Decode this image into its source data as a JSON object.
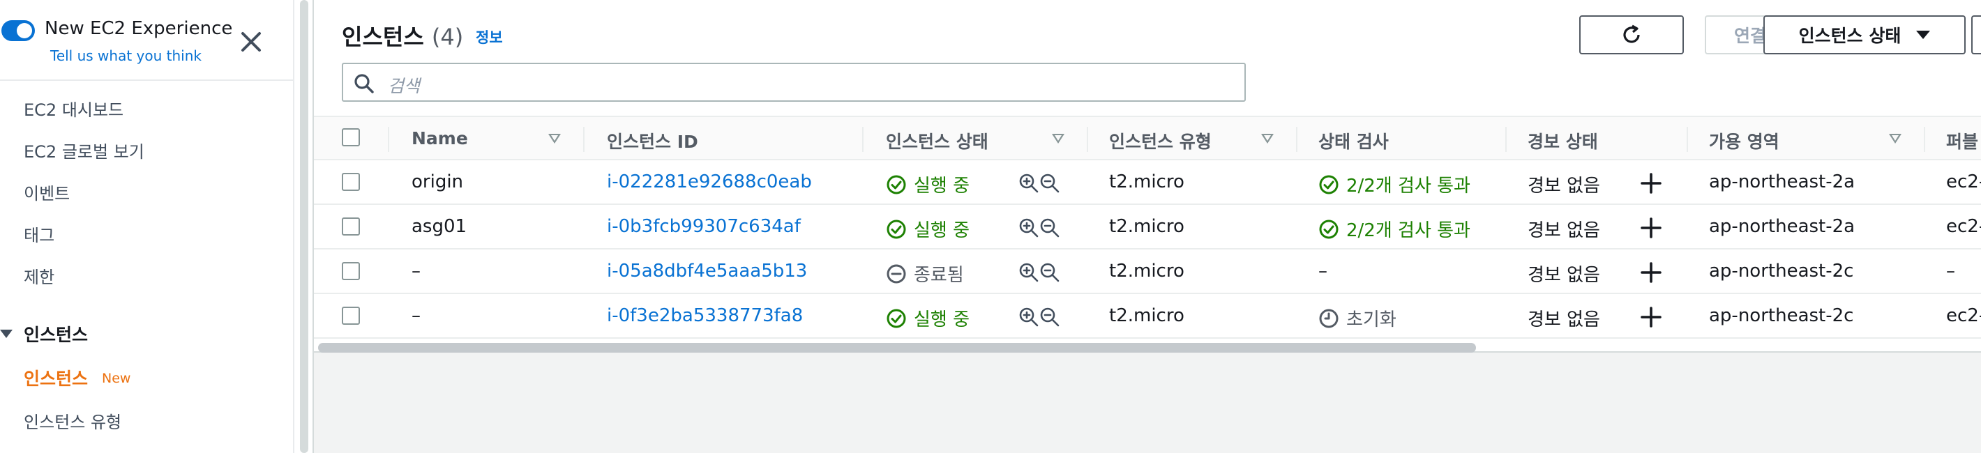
{
  "sidebar": {
    "experience_title": "New EC2 Experience",
    "experience_sub": "Tell us what you think",
    "items": [
      "EC2 대시보드",
      "EC2 글로벌 보기",
      "이벤트",
      "태그",
      "제한"
    ],
    "section_label": "인스턴스",
    "active_item": "인스턴스",
    "active_badge": "New",
    "next_item": "인스턴스 유형"
  },
  "panel": {
    "title": "인스턴스",
    "count": "(4)",
    "info": "정보",
    "buttons": {
      "refresh": "",
      "connect": "연결",
      "instance_state": "인스턴스 상태"
    },
    "search_placeholder": "검색"
  },
  "table": {
    "columns": [
      "Name",
      "인스턴스 ID",
      "인스턴스 상태",
      "인스턴스 유형",
      "상태 검사",
      "경보 상태",
      "가용 영역",
      "퍼블"
    ],
    "rows": [
      {
        "name": "origin",
        "id": "i-022281e92688c0eab",
        "state": "실행 중",
        "state_kind": "running",
        "type": "t2.micro",
        "check": "2/2개 검사 통과",
        "check_kind": "passed",
        "alarm": "경보 없음",
        "az": "ap-northeast-2a",
        "public": "ec2-"
      },
      {
        "name": "asg01",
        "id": "i-0b3fcb99307c634af",
        "state": "실행 중",
        "state_kind": "running",
        "type": "t2.micro",
        "check": "2/2개 검사 통과",
        "check_kind": "passed",
        "alarm": "경보 없음",
        "az": "ap-northeast-2a",
        "public": "ec2-"
      },
      {
        "name": "–",
        "id": "i-05a8dbf4e5aaa5b13",
        "state": "종료됨",
        "state_kind": "terminated",
        "type": "t2.micro",
        "check": "–",
        "check_kind": "none",
        "alarm": "경보 없음",
        "az": "ap-northeast-2c",
        "public": "–"
      },
      {
        "name": "–",
        "id": "i-0f3e2ba5338773fa8",
        "state": "실행 중",
        "state_kind": "running",
        "type": "t2.micro",
        "check": "초기화",
        "check_kind": "init",
        "alarm": "경보 없음",
        "az": "ap-northeast-2c",
        "public": "ec2-"
      }
    ]
  },
  "colors": {
    "accent": "#0972d3",
    "active_nav": "#ec7211",
    "success": "#1d8102"
  }
}
